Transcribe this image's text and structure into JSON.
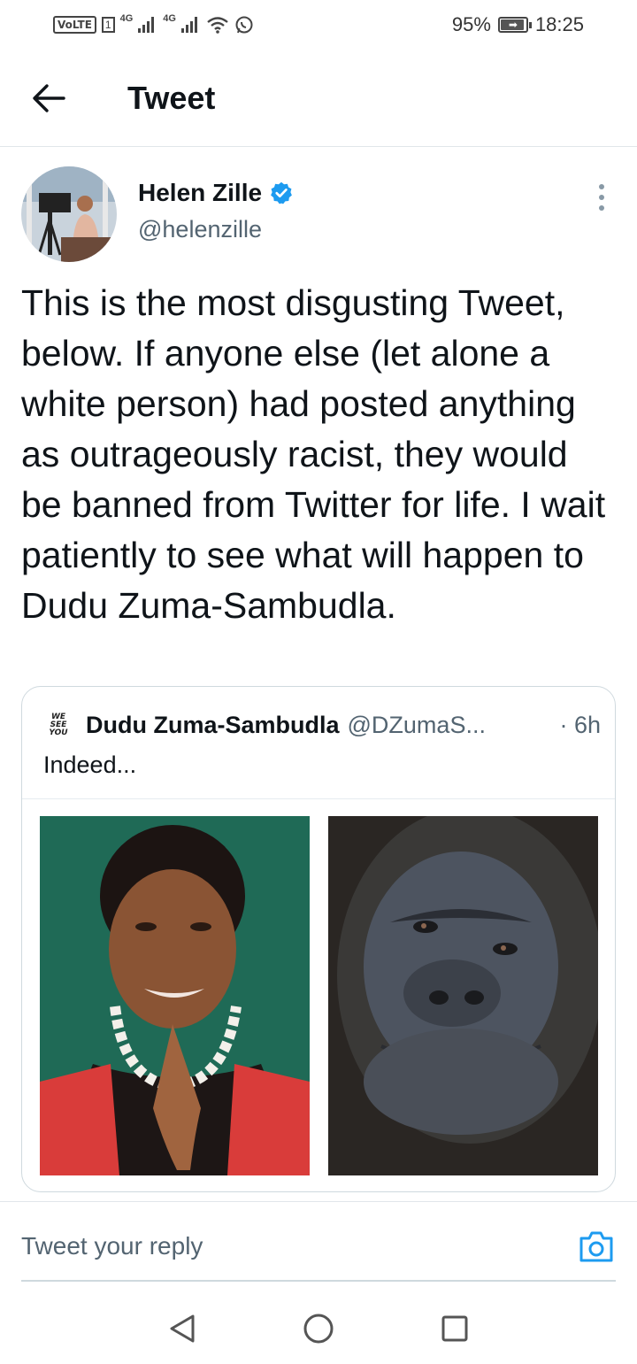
{
  "status_bar": {
    "volte": "VoLTE",
    "sim1_badge": "1",
    "network_1": "4G",
    "network_2": "4G",
    "battery_percent": "95%",
    "battery_level": 0.95,
    "time": "18:25",
    "icons": [
      "signal-icon",
      "signal-icon",
      "wifi-icon",
      "whatsapp-icon",
      "battery-icon"
    ]
  },
  "header": {
    "title": "Tweet",
    "back_icon": "arrow-left-icon"
  },
  "tweet": {
    "author_name": "Helen Zille",
    "verified": true,
    "handle": "@helenzille",
    "text": "This is the most disgusting Tweet, below.  If anyone else (let alone a white person) had posted anything as outrageously racist, they would be banned from Twitter for life.  I wait patiently to see what will happen to Dudu Zuma-Sambudla."
  },
  "quoted_tweet": {
    "avatar_text": [
      "WE",
      "SEE",
      "YOU"
    ],
    "author_name": "Dudu Zuma-Sambudla",
    "handle": "@DZumaS...",
    "time": "· 6h",
    "text": "Indeed..."
  },
  "reply": {
    "placeholder": "Tweet your reply",
    "camera_icon": "camera-icon"
  },
  "nav": {
    "icons": [
      "back-triangle-icon",
      "home-circle-icon",
      "recents-square-icon"
    ]
  },
  "colors": {
    "verified": "#1d9bf0",
    "accent": "#1d9bf0",
    "text": "#0f1419",
    "secondary": "#536471"
  }
}
